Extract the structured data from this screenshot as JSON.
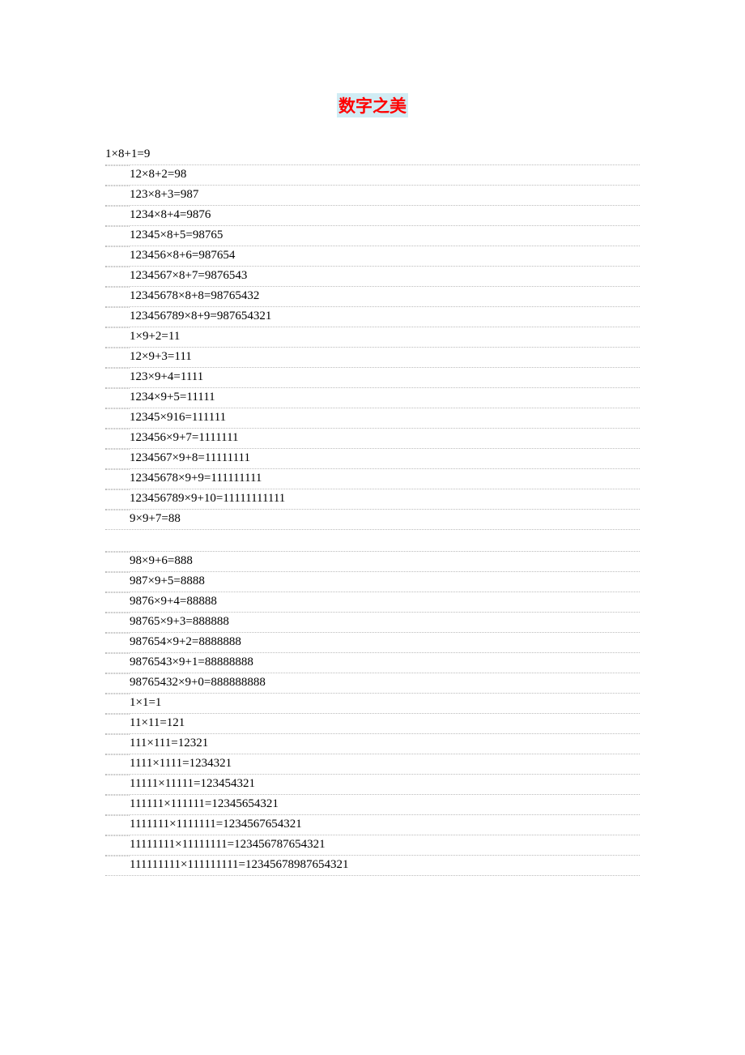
{
  "title": "数字之美",
  "lines": [
    {
      "text": "1×8+1=9",
      "firstLine": true
    },
    {
      "text": "12×8+2=98"
    },
    {
      "text": "123×8+3=987"
    },
    {
      "text": "1234×8+4=9876"
    },
    {
      "text": "12345×8+5=98765"
    },
    {
      "text": "123456×8+6=987654"
    },
    {
      "text": "1234567×8+7=9876543"
    },
    {
      "text": "12345678×8+8=98765432"
    },
    {
      "text": "123456789×8+9=987654321"
    },
    {
      "text": "1×9+2=11"
    },
    {
      "text": "12×9+3=111"
    },
    {
      "text": "123×9+4=1111"
    },
    {
      "text": "1234×9+5=11111"
    },
    {
      "text": "12345×916=111111"
    },
    {
      "text": "123456×9+7=1111111"
    },
    {
      "text": "1234567×9+8=11111111"
    },
    {
      "text": "12345678×9+9=111111111"
    },
    {
      "text": "123456789×9+10=11111111111"
    },
    {
      "text": "9×9+7=88"
    },
    {
      "blank": true
    },
    {
      "text": "98×9+6=888"
    },
    {
      "text": "987×9+5=8888"
    },
    {
      "text": "9876×9+4=88888"
    },
    {
      "text": "98765×9+3=888888"
    },
    {
      "text": "987654×9+2=8888888"
    },
    {
      "text": "9876543×9+1=88888888"
    },
    {
      "text": "98765432×9+0=888888888"
    },
    {
      "text": "1×1=1"
    },
    {
      "text": "11×11=121"
    },
    {
      "text": "111×111=12321"
    },
    {
      "text": "1111×1111=1234321"
    },
    {
      "text": "11111×11111=123454321"
    },
    {
      "text": "111111×111111=12345654321"
    },
    {
      "text": "1111111×1111111=1234567654321"
    },
    {
      "text": "11111111×11111111=123456787654321"
    },
    {
      "text": "111111111×111111111=12345678987654321"
    }
  ]
}
